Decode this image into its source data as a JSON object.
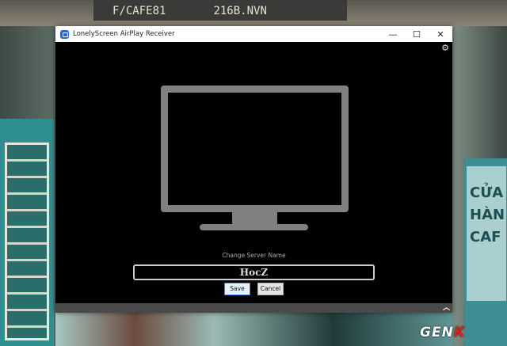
{
  "background": {
    "sign_texts": [
      "F/CAFE81",
      "216B.NVN"
    ],
    "right_sign": "CỬA HÀN CAF"
  },
  "window": {
    "title": "LonelyScreen AirPlay Receiver",
    "controls": {
      "minimize": "—",
      "maximize": "☐",
      "close": "✕"
    }
  },
  "content": {
    "label": "Change Server Name",
    "server_name": "HocZ",
    "save_label": "Save",
    "cancel_label": "Cancel"
  },
  "watermark": {
    "text_main": "GEN",
    "text_accent": "K"
  },
  "colors": {
    "accent": "#2f66c7",
    "monitor": "#808080"
  }
}
